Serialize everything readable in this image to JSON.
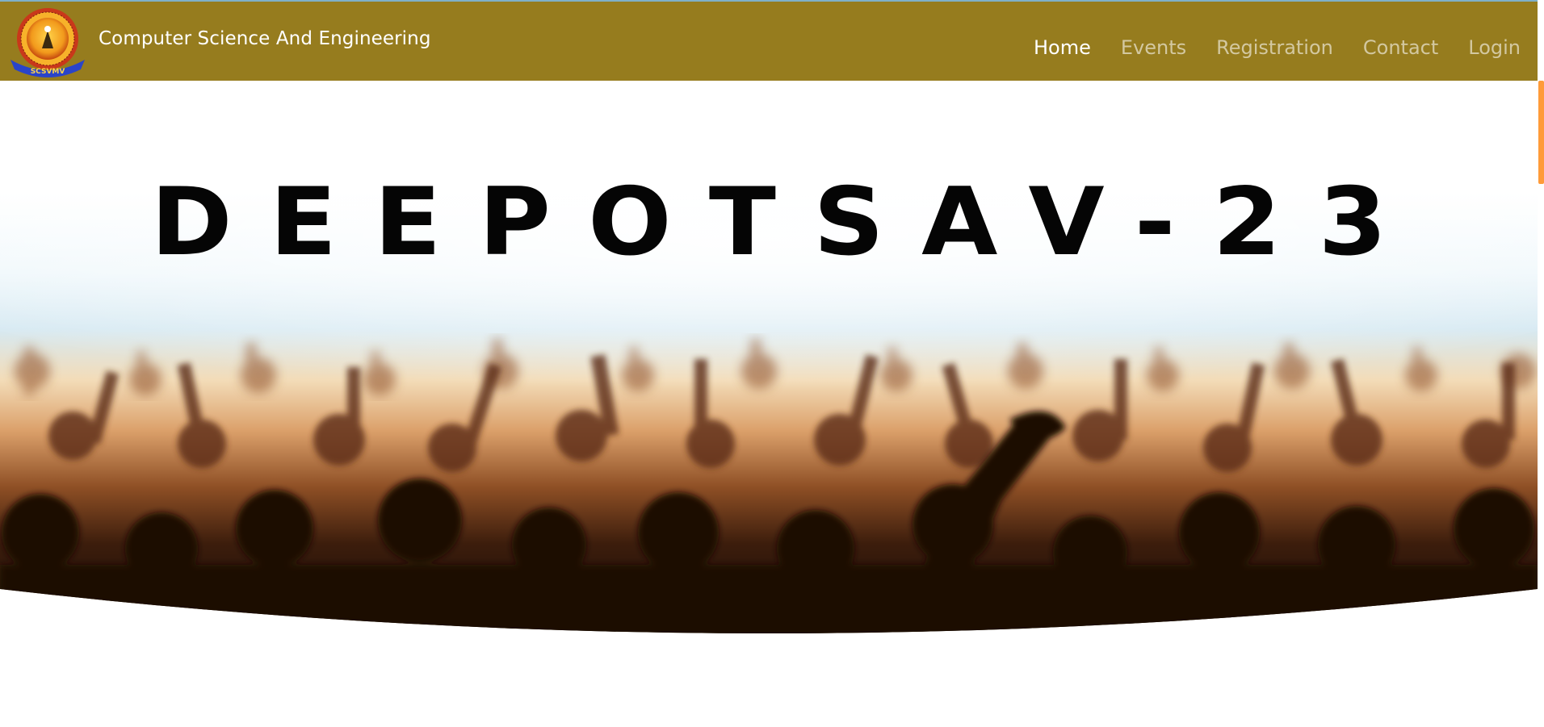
{
  "header": {
    "brand": "Computer Science And Engineering",
    "logo_icon": "university-emblem-icon",
    "logo_ribbon_text": "SCSVMV"
  },
  "nav": {
    "items": [
      {
        "label": "Home",
        "active": true
      },
      {
        "label": "Events",
        "active": false
      },
      {
        "label": "Registration",
        "active": false
      },
      {
        "label": "Contact",
        "active": false
      },
      {
        "label": "Login",
        "active": false
      }
    ]
  },
  "hero": {
    "title": "DEEPOTSAV-23",
    "background": "concert-crowd-image"
  },
  "colors": {
    "navbar": "#967c1e",
    "scroll_thumb": "#ff9b39",
    "title": "#050505"
  }
}
